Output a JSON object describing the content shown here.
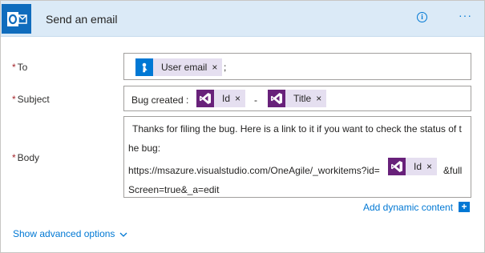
{
  "header": {
    "title": "Send an email",
    "app_icon": "outlook-icon",
    "info_icon": "info-icon",
    "more_icon": "more-options-icon",
    "background": "#dbeaf7",
    "brand_color": "#0f6cbd"
  },
  "fields": {
    "to": {
      "label": "To",
      "required_mark": "*",
      "token_label": "User email",
      "token_icon": "user-icon",
      "separator": ";"
    },
    "subject": {
      "label": "Subject",
      "required_mark": "*",
      "prefix": "Bug created :",
      "token1_label": "Id",
      "dash": "-",
      "token2_label": "Title",
      "token_icon": "visual-studio-icon"
    },
    "body": {
      "label": "Body",
      "required_mark": "*",
      "line1": "Thanks for filing the bug. Here is a link to it if you want to check the status of t",
      "line2": "he bug:",
      "line3_prefix": "https://msazure.visualstudio.com/OneAgile/_workitems?id=",
      "token_label": "Id",
      "line3_suffix": "&full",
      "line4": "Screen=true&_a=edit",
      "token_icon": "visual-studio-icon"
    }
  },
  "token_remove_glyph": "×",
  "dynamic_content": {
    "label": "Add dynamic content",
    "plus": "+"
  },
  "advanced": {
    "label": "Show advanced options",
    "chevron": "⌄"
  },
  "colors": {
    "link": "#0078d4",
    "required": "#a4262c",
    "token_bg": "#e5dff0",
    "vs_purple": "#68217a"
  }
}
